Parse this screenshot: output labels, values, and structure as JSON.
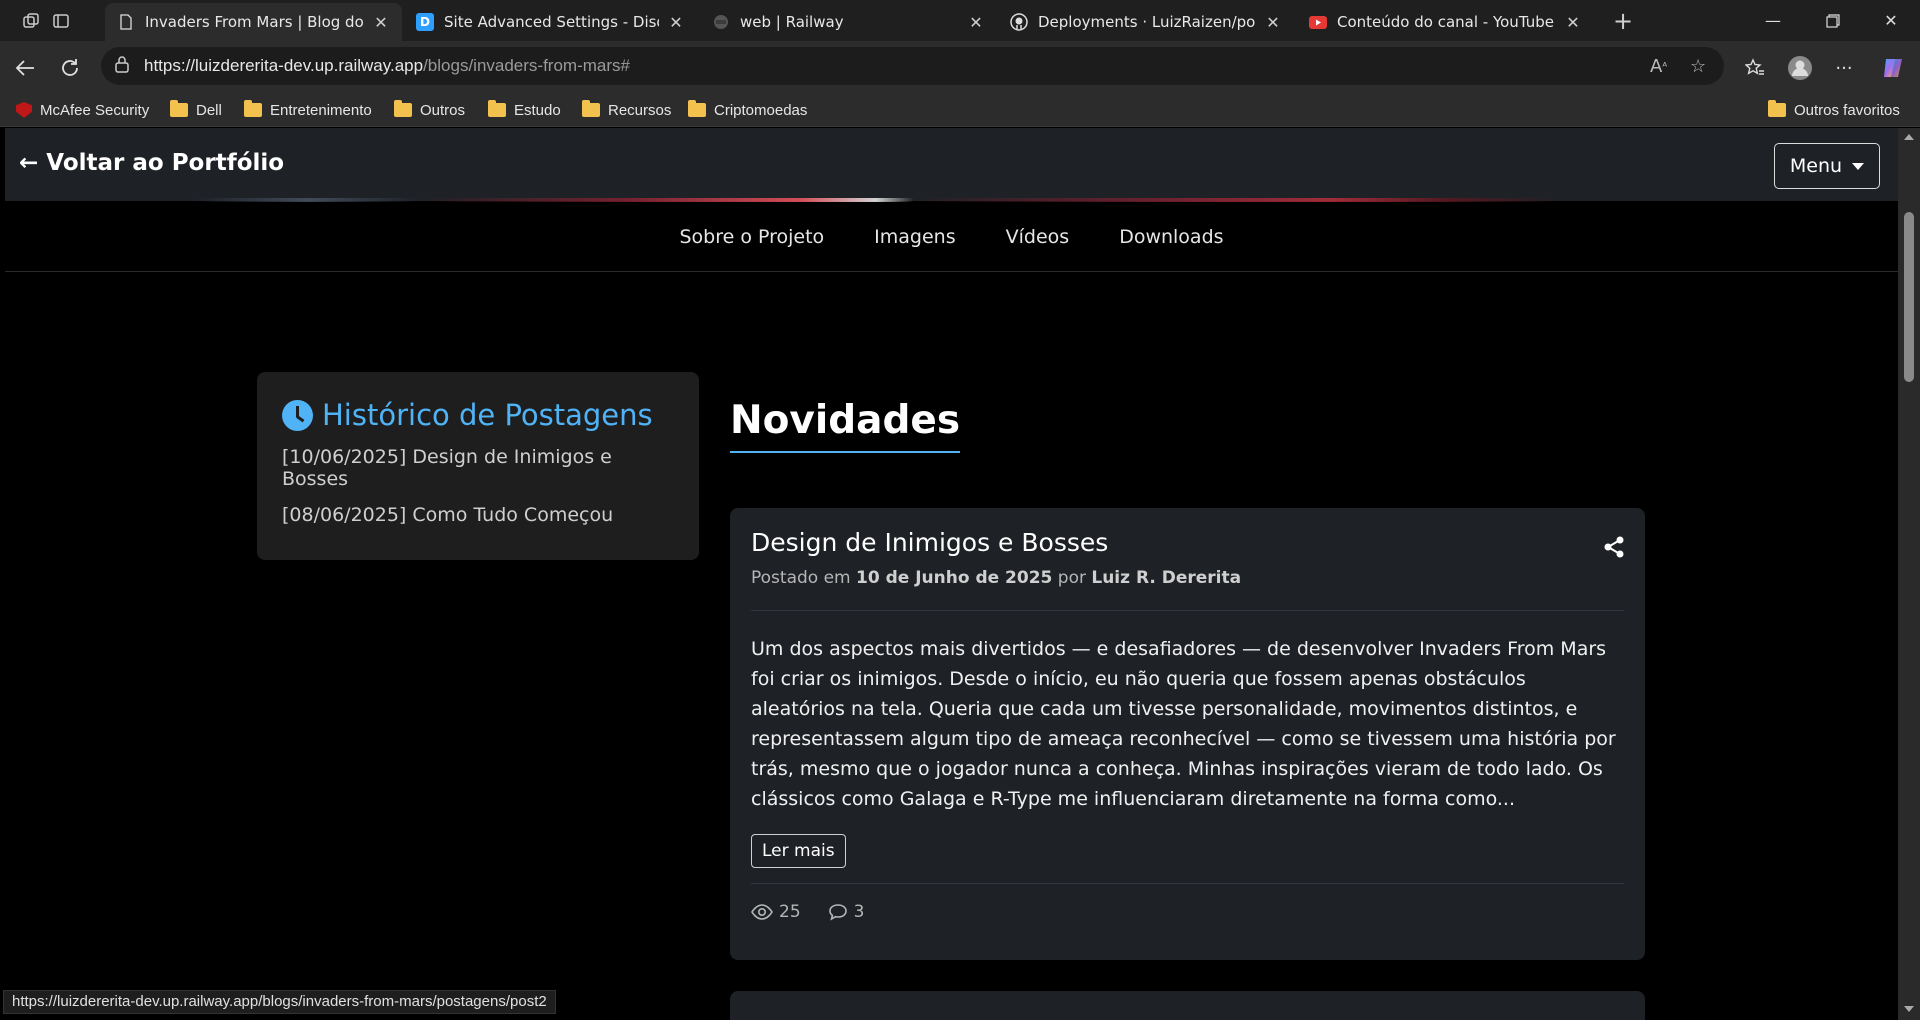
{
  "browser": {
    "tabs": [
      {
        "title": "Invaders From Mars | Blog do Proj",
        "icon": "page-icon",
        "active": true
      },
      {
        "title": "Site Advanced Settings - Disqus A",
        "icon": "disqus-icon",
        "active": false
      },
      {
        "title": "web | Railway",
        "icon": "railway-icon",
        "active": false
      },
      {
        "title": "Deployments · LuizRaizen/portfoli",
        "icon": "github-icon",
        "active": false
      },
      {
        "title": "Conteúdo do canal - YouTube Stu",
        "icon": "youtube-icon",
        "active": false
      }
    ],
    "url_host": "https://luizdererita-dev.up.railway.app",
    "url_path": "/blogs/invaders-from-mars#",
    "bookmarks": [
      "McAfee Security",
      "Dell",
      "Entretenimento",
      "Outros",
      "Estudo",
      "Recursos",
      "Criptomoedas"
    ],
    "other_favorites": "Outros favoritos",
    "status_url": "https://luizdererita-dev.up.railway.app/blogs/invaders-from-mars/postagens/post2"
  },
  "site": {
    "back_link": "← Voltar ao Portfólio",
    "menu_label": "Menu",
    "subnav": [
      "Sobre o Projeto",
      "Imagens",
      "Vídeos",
      "Downloads"
    ],
    "history": {
      "title": "Histórico de Postagens",
      "items": [
        "[10/06/2025] Design de Inimigos e Bosses",
        "[08/06/2025] Como Tudo Começou"
      ]
    },
    "section_title": "Novidades",
    "post": {
      "title": "Design de Inimigos e Bosses",
      "meta_prefix": "Postado em",
      "date": "10 de Junho de 2025",
      "meta_by": "por",
      "author": "Luiz R. Dererita",
      "excerpt": "Um dos aspectos mais divertidos — e desafiadores — de desenvolver Invaders From Mars foi criar os inimigos. Desde o início, eu não queria que fossem apenas obstáculos aleatórios na tela. Queria que cada um tivesse personalidade, movimentos distintos, e representassem algum tipo de ameaça reconhecível — como se tivessem uma história por trás, mesmo que o jogador nunca a conheça. Minhas inspirações vieram de todo lado. Os clássicos como Galaga e R-Type me influenciaram diretamente na forma como...",
      "read_more": "Ler mais",
      "views": "25",
      "comments": "3"
    }
  },
  "colors": {
    "accent": "#4fb3f6",
    "card_bg": "#1e2126",
    "page_bg": "#000000"
  }
}
